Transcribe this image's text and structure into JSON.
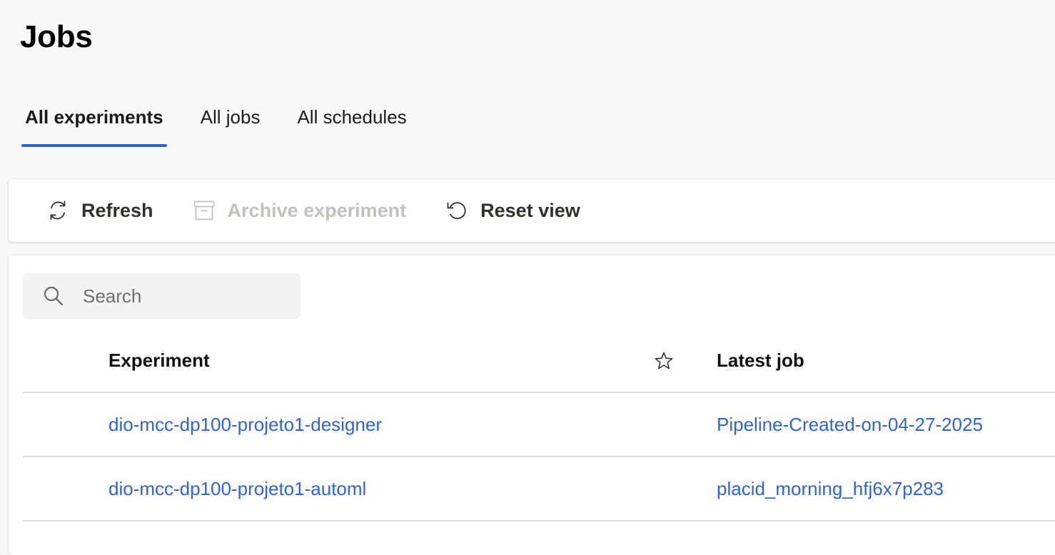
{
  "page": {
    "title": "Jobs"
  },
  "tabs": [
    {
      "label": "All experiments",
      "active": true
    },
    {
      "label": "All jobs",
      "active": false
    },
    {
      "label": "All schedules",
      "active": false
    }
  ],
  "toolbar": {
    "refresh": {
      "label": "Refresh",
      "icon": "refresh-icon"
    },
    "archive": {
      "label": "Archive experiment",
      "icon": "archive-icon",
      "disabled": true
    },
    "reset": {
      "label": "Reset view",
      "icon": "undo-icon"
    }
  },
  "search": {
    "placeholder": "Search",
    "value": ""
  },
  "table": {
    "columns": {
      "experiment": "Experiment",
      "favorite_icon": "star-icon",
      "latest_job": "Latest job"
    },
    "rows": [
      {
        "experiment": "dio-mcc-dp100-projeto1-designer",
        "latest_job": "Pipeline-Created-on-04-27-2025"
      },
      {
        "experiment": "dio-mcc-dp100-projeto1-automl",
        "latest_job": "placid_morning_hfj6x7p283"
      }
    ]
  },
  "colors": {
    "accent": "#2f63d6",
    "disabled_text": "#c2c1c0",
    "background": "#f8f8f8"
  }
}
